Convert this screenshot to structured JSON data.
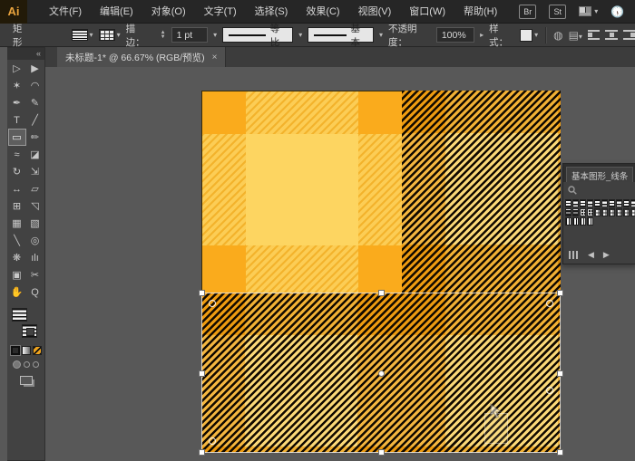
{
  "app": {
    "logo": "Ai"
  },
  "menu_bar": {
    "items": [
      {
        "label": "文件(F)"
      },
      {
        "label": "编辑(E)"
      },
      {
        "label": "对象(O)"
      },
      {
        "label": "文字(T)"
      },
      {
        "label": "选择(S)"
      },
      {
        "label": "效果(C)"
      },
      {
        "label": "视图(V)"
      },
      {
        "label": "窗口(W)"
      },
      {
        "label": "帮助(H)"
      }
    ],
    "bridge_button": "Br",
    "stock_button": "St"
  },
  "control_bar": {
    "tool_label": "矩形",
    "stroke_label": "描边：",
    "stroke_value": "1 pt",
    "profile_value": "等比",
    "brush_value": "基本",
    "opacity_label": "不透明度：",
    "opacity_value": "100%",
    "style_label": "样式："
  },
  "document_tab": {
    "title": "未标题-1* @ 66.67% (RGB/预览)",
    "close": "×"
  },
  "tool_panel": {
    "collapse": "«",
    "tools": [
      {
        "name": "direct-selection-tool"
      },
      {
        "name": "selection-tool"
      },
      {
        "name": "magic-wand-tool"
      },
      {
        "name": "lasso-tool"
      },
      {
        "name": "pen-tool"
      },
      {
        "name": "curvature-tool"
      },
      {
        "name": "type-tool"
      },
      {
        "name": "line-segment-tool"
      },
      {
        "name": "rectangle-tool",
        "selected": true
      },
      {
        "name": "paintbrush-tool"
      },
      {
        "name": "pencil-tool"
      },
      {
        "name": "eraser-tool"
      },
      {
        "name": "rotate-tool"
      },
      {
        "name": "scale-tool"
      },
      {
        "name": "width-tool"
      },
      {
        "name": "free-transform-tool"
      },
      {
        "name": "shape-builder-tool"
      },
      {
        "name": "perspective-grid-tool"
      },
      {
        "name": "mesh-tool"
      },
      {
        "name": "gradient-tool"
      },
      {
        "name": "eyedropper-tool"
      },
      {
        "name": "blend-tool"
      },
      {
        "name": "symbol-sprayer-tool"
      },
      {
        "name": "column-graph-tool"
      },
      {
        "name": "artboard-tool"
      },
      {
        "name": "slice-tool"
      },
      {
        "name": "hand-tool"
      },
      {
        "name": "zoom-tool"
      }
    ]
  },
  "library_panel": {
    "title": "基本图形_线条",
    "swatch_rows": [
      [
        "hl-fine",
        "hl-med",
        "hl-fine",
        "hl-med",
        "hl-fine",
        "hl-med",
        "hl-fine",
        "hl-med",
        "hl-fine",
        "hl-med"
      ],
      [
        "dk-h",
        "dk-h",
        "dk-chk",
        "dk-chk",
        "chk",
        "chk",
        "chk",
        "chk",
        "chk",
        "chk"
      ],
      [
        "vl",
        "vl",
        "vl",
        "vl",
        "blank",
        "blank",
        "blank",
        "blank",
        "blank",
        "blank"
      ]
    ]
  },
  "colors": {
    "accent_orange": "#FAAB1C",
    "plaid_center": "#FDD561",
    "plaid_band": "#FCCD55",
    "stripe_dark": "#120A00",
    "stripe_gold": "#F9D065",
    "workspace_gray": "#585858"
  }
}
